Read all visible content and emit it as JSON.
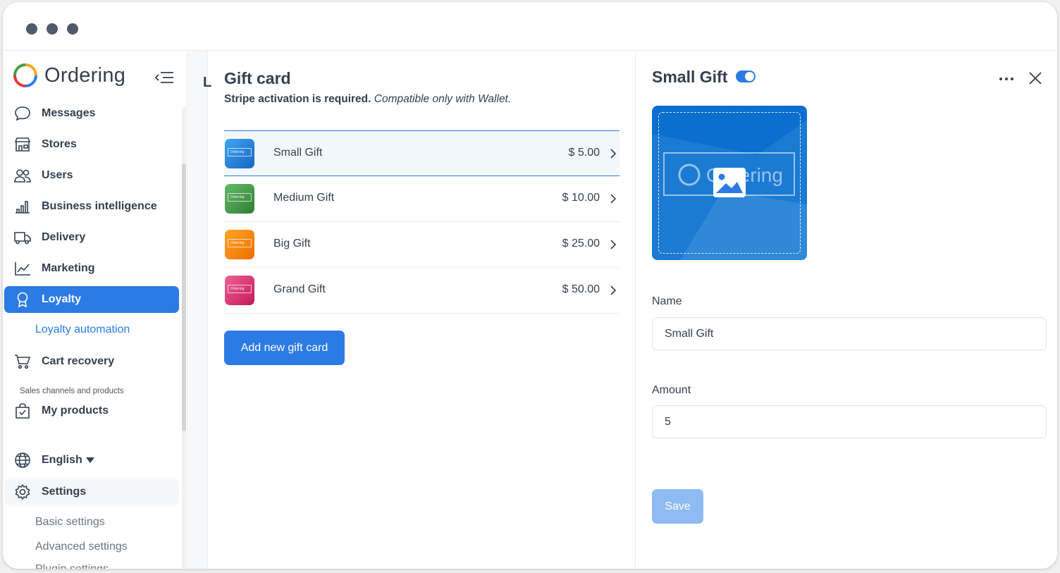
{
  "app": {
    "logo_text": "Ordering"
  },
  "sidebar": {
    "items": [
      {
        "label": "Messages",
        "icon": "chat-bubble-icon"
      },
      {
        "label": "Stores",
        "icon": "store-icon"
      },
      {
        "label": "Users",
        "icon": "users-icon"
      },
      {
        "label": "Business intelligence",
        "icon": "bar-chart-icon"
      },
      {
        "label": "Delivery",
        "icon": "truck-icon"
      },
      {
        "label": "Marketing",
        "icon": "line-chart-icon"
      },
      {
        "label": "Loyalty",
        "icon": "award-icon",
        "active": true
      },
      {
        "label": "Cart recovery",
        "icon": "cart-icon"
      },
      {
        "label": "My products",
        "icon": "bag-icon"
      }
    ],
    "loyalty_sub": "Loyalty automation",
    "section_label": "Sales channels and products",
    "language": "English",
    "settings_label": "Settings",
    "settings_sub": [
      "Basic settings",
      "Advanced settings",
      "Plugin settings"
    ]
  },
  "middle": {
    "cut_letter": "L",
    "title": "Gift card",
    "subtitle_bold": "Stripe activation is required.",
    "subtitle_italic": "Compatible only with Wallet.",
    "cards": [
      {
        "name": "Small Gift",
        "amount": "$ 5.00",
        "color": "#1e88e5",
        "selected": true
      },
      {
        "name": "Medium Gift",
        "amount": "$ 10.00",
        "color": "#43a047"
      },
      {
        "name": "Big Gift",
        "amount": "$ 25.00",
        "color": "#fb8c00"
      },
      {
        "name": "Grand Gift",
        "amount": "$ 50.00",
        "color": "#e91e63"
      }
    ],
    "thumb_text": "Ordering",
    "add_button": "Add new gift card"
  },
  "detail": {
    "title": "Small Gift",
    "enabled": true,
    "image_text": "Ordering",
    "name_label": "Name",
    "name_value": "Small Gift",
    "amount_label": "Amount",
    "amount_value": "5",
    "save_label": "Save"
  },
  "colors": {
    "primary": "#2c7be5",
    "card_blue": "#0a6fcf",
    "save_disabled": "#8fbaf2"
  }
}
